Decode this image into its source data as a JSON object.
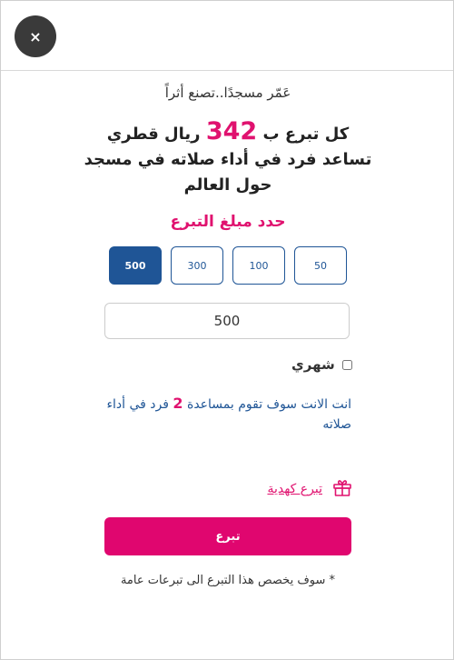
{
  "header": {
    "close_label": "×"
  },
  "tagline": "عَمّر مسجدًا..تصنع أثراً",
  "headline": {
    "line1_before": "كل تبرع ب",
    "amount": "342",
    "line1_after": "ريال قطري",
    "line2": "تساعد فرد في أداء صلاته في مسجد",
    "line3": "حول العالم"
  },
  "select_title": "حدد مبلغ التبرع",
  "amount_options": [
    {
      "label": "500",
      "selected": true
    },
    {
      "label": "300",
      "selected": false
    },
    {
      "label": "100",
      "selected": false
    },
    {
      "label": "50",
      "selected": false
    }
  ],
  "amount_input": {
    "value": "500"
  },
  "monthly": {
    "label": "شهري",
    "checked": false
  },
  "impact": {
    "before": "انت الانت سوف تقوم بمساعدة",
    "count": "2",
    "after": "فرد في أداء صلاته"
  },
  "gift": {
    "label": "تبرع كهدية",
    "icon": "gift-icon"
  },
  "donate_button": "تبرع",
  "footnote": "* سوف يخصص هذا التبرع الى تبرعات عامة",
  "colors": {
    "accent": "#e0126f",
    "primary": "#1f5596",
    "close_bg": "#3a3a3a"
  }
}
